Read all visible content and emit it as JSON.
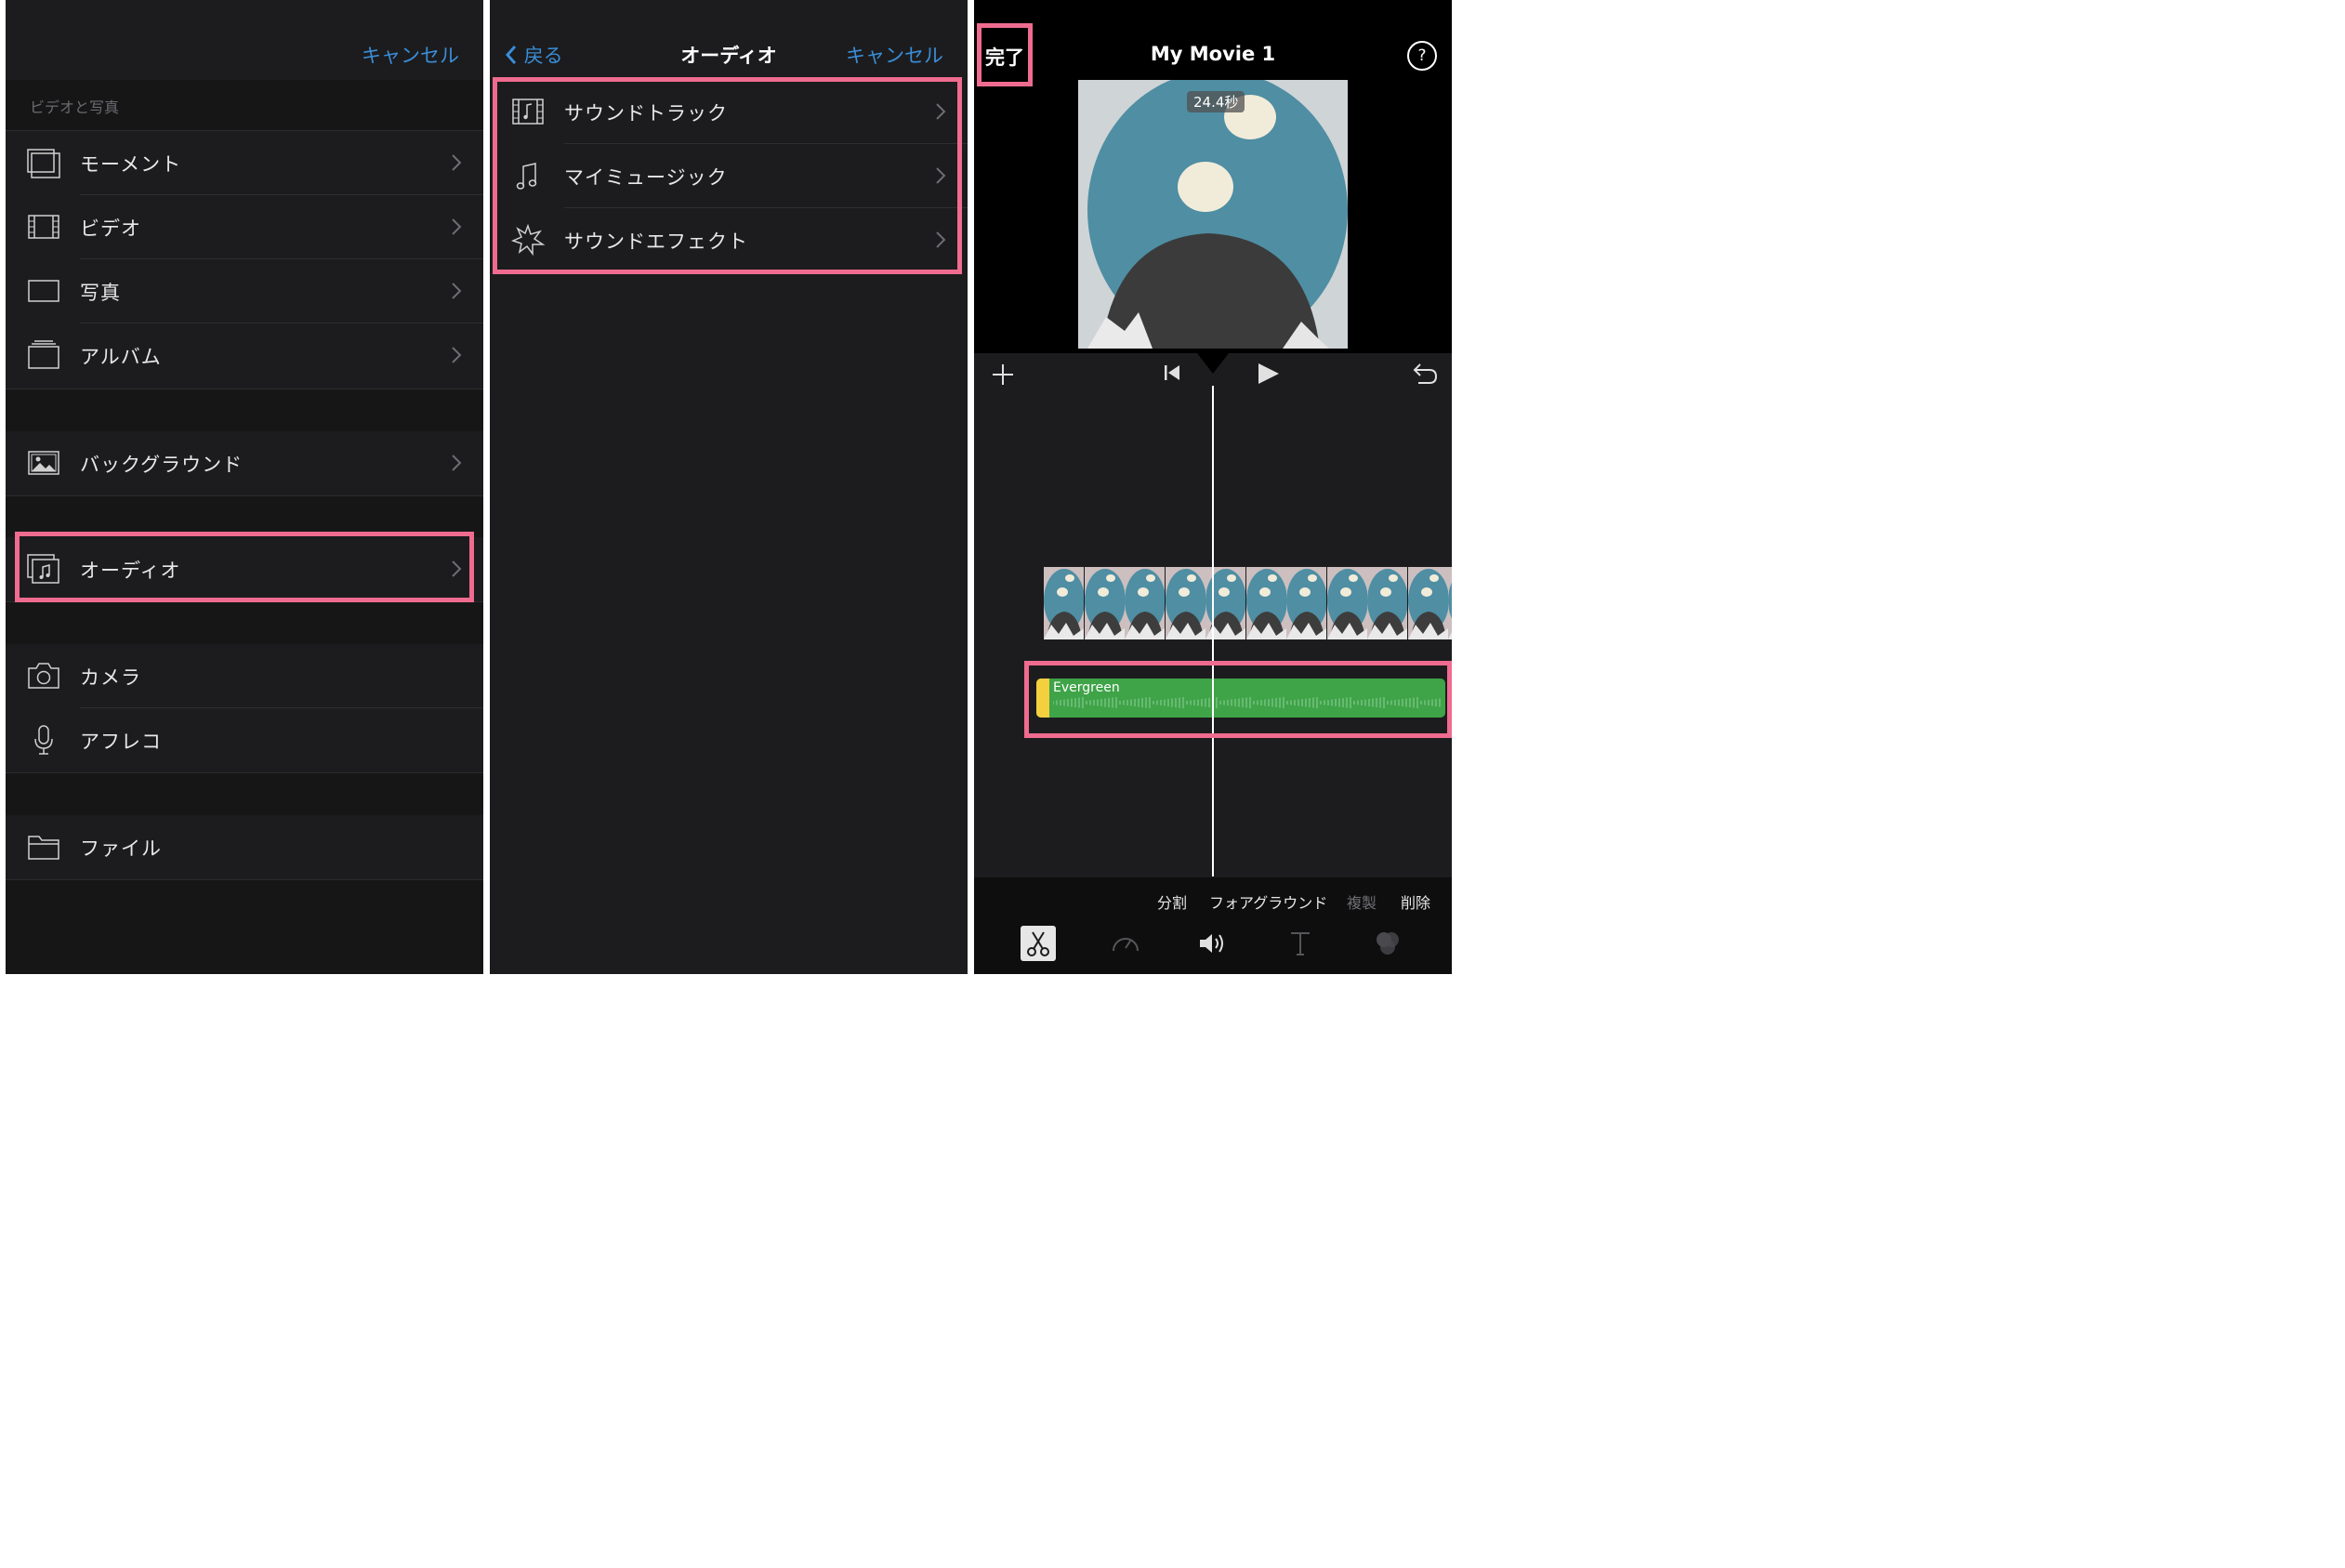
{
  "panel1": {
    "cancel": "キャンセル",
    "section_video_photo": "ビデオと写真",
    "items": [
      {
        "label": "モーメント",
        "icon": "moments-icon"
      },
      {
        "label": "ビデオ",
        "icon": "film-icon"
      },
      {
        "label": "写真",
        "icon": "photo-frame-icon"
      },
      {
        "label": "アルバム",
        "icon": "album-icon"
      },
      {
        "label": "バックグラウンド",
        "icon": "background-image-icon"
      },
      {
        "label": "オーディオ",
        "icon": "audio-icon"
      },
      {
        "label": "カメラ",
        "icon": "camera-icon"
      },
      {
        "label": "アフレコ",
        "icon": "microphone-icon"
      },
      {
        "label": "ファイル",
        "icon": "folder-icon"
      }
    ]
  },
  "panel2": {
    "back": "戻る",
    "title": "オーディオ",
    "cancel": "キャンセル",
    "items": [
      {
        "label": "サウンドトラック",
        "icon": "soundtrack-icon"
      },
      {
        "label": "マイミュージック",
        "icon": "music-note-icon"
      },
      {
        "label": "サウンドエフェクト",
        "icon": "sound-effect-icon"
      }
    ]
  },
  "panel3": {
    "done": "完了",
    "title": "My Movie 1",
    "help": "?",
    "duration": "24.4秒",
    "audio_clip_name": "Evergreen",
    "actions": {
      "split": "分割",
      "foreground": "フォアグラウンド",
      "duplicate": "複製",
      "delete": "削除"
    },
    "tools": [
      "scissors-icon",
      "speed-icon",
      "volume-icon",
      "title-icon",
      "filter-icon"
    ]
  },
  "colors": {
    "accent": "#3a8ed8",
    "highlight": "#ef6b8f",
    "audio_green": "#3fa348",
    "audio_handle": "#f4d03f",
    "panel_bg": "#1c1c1e"
  }
}
